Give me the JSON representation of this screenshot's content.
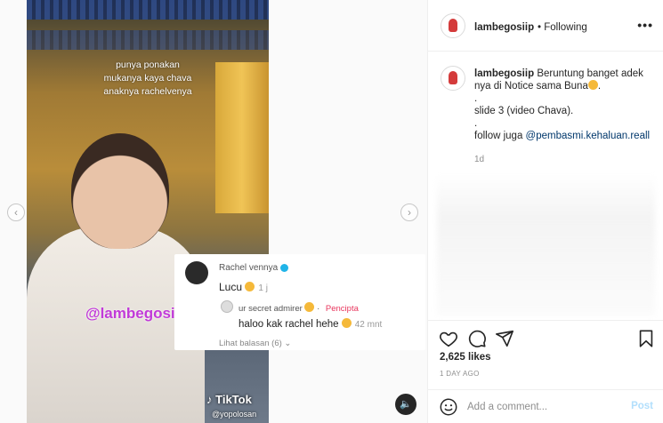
{
  "media": {
    "overlay_lines": [
      "punya ponakan",
      "mukanya kaya chava",
      "anaknya rachelvenya"
    ],
    "watermark": "@lambegosiip",
    "tiktok_logo": "TikTok",
    "tiktok_user": "@yopolosan",
    "nav_prev_icon": "chevron-left-icon",
    "nav_next_icon": "chevron-right-icon",
    "sound_icon": "speaker-icon",
    "comment_card": {
      "author": "Rachel vennya",
      "text": "Lucu",
      "time": "1 j",
      "reply_author": "ur secret admirer",
      "creator_label": "Pencipta",
      "reply_text": "haloo kak rachel hehe",
      "reply_time": "42 mnt",
      "view_replies": "Lihat balasan (6)"
    }
  },
  "post": {
    "username": "lambegosiip",
    "follow_status": "• Following",
    "more_icon": "•••",
    "caption_text": "Beruntung banget adek nya di Notice sama Buna",
    "caption_dot1": ".",
    "caption_slide": "slide 3 (video Chava).",
    "caption_dot2": ".",
    "caption_follow_prefix": "follow juga ",
    "caption_mention": "@pembasmi.kehaluan.reall",
    "caption_time": "1d",
    "likes": "2,625 likes",
    "date": "1 DAY AGO",
    "comment_placeholder": "Add a comment...",
    "post_label": "Post"
  }
}
